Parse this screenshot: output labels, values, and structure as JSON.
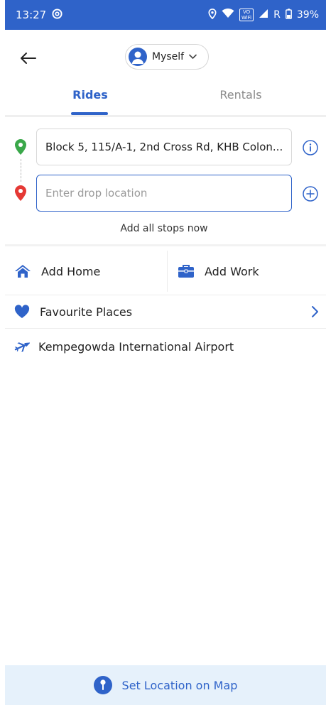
{
  "status_bar": {
    "time": "13:27",
    "vowifi_top": "VO",
    "vowifi_bottom": "WiFi",
    "network": "R",
    "battery": "39%"
  },
  "header": {
    "profile_label": "Myself"
  },
  "tabs": [
    {
      "label": "Rides",
      "active": true
    },
    {
      "label": "Rentals",
      "active": false
    }
  ],
  "locations": {
    "pickup_value": "Block 5, 115/A-1, 2nd Cross Rd, KHB Colon...",
    "drop_placeholder": "Enter drop location",
    "add_stops_label": "Add all stops now"
  },
  "shortcuts": {
    "home_label": "Add Home",
    "work_label": "Add Work"
  },
  "favourites_label": "Favourite Places",
  "suggestions": [
    {
      "label": "Kempegowda International Airport",
      "icon": "airplane-icon"
    }
  ],
  "map_bar_label": "Set Location on Map",
  "colors": {
    "accent": "#2f63c9",
    "pickup_pin": "#3aa84a",
    "drop_pin": "#e53935",
    "map_bar_bg": "#e6f1fb"
  }
}
